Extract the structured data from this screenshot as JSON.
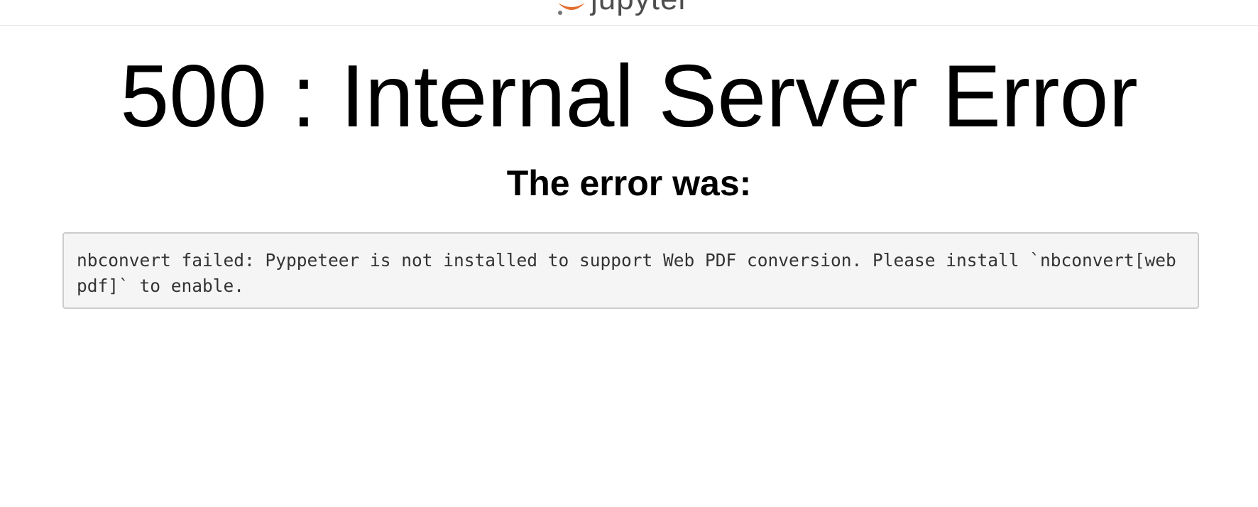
{
  "header": {
    "logo_text": "jupyter",
    "logo_colors": {
      "orange": "#e46e2e",
      "gray": "#767677",
      "wordmark": "#4e4e4e"
    }
  },
  "error": {
    "title": "500 : Internal Server Error",
    "subtitle": "The error was:",
    "message": "nbconvert failed: Pyppeteer is not installed to support Web PDF conversion. Please install `nbconvert[webpdf]` to enable."
  }
}
